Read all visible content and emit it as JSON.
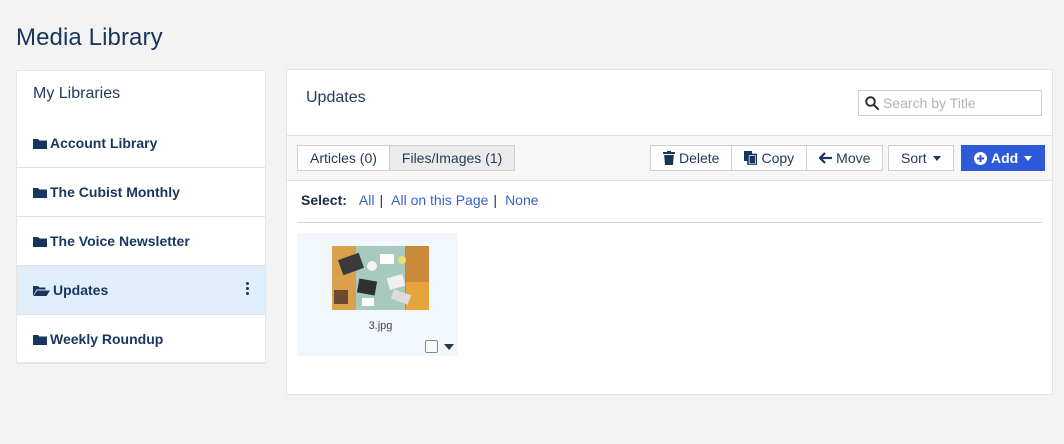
{
  "page_title": "Media Library",
  "sidebar": {
    "heading": "My Libraries",
    "items": [
      {
        "label": "Account Library",
        "icon": "folder-icon"
      },
      {
        "label": "The Cubist Monthly",
        "icon": "folder-icon"
      },
      {
        "label": "The Voice Newsletter",
        "icon": "folder-icon"
      },
      {
        "label": "Updates",
        "icon": "folder-open-icon",
        "active": true
      },
      {
        "label": "Weekly Roundup",
        "icon": "folder-icon"
      }
    ]
  },
  "main": {
    "title": "Updates",
    "search": {
      "placeholder": "Search by Title",
      "value": ""
    },
    "tabs": [
      {
        "label": "Articles (0)",
        "active": false
      },
      {
        "label": "Files/Images (1)",
        "active": true
      }
    ],
    "actions": {
      "delete": "Delete",
      "copy": "Copy",
      "move": "Move",
      "sort": "Sort",
      "add": "Add"
    },
    "select": {
      "label": "Select:",
      "all": "All",
      "all_on_page": "All on this Page",
      "none": "None"
    },
    "files": [
      {
        "name": "3.jpg"
      }
    ]
  },
  "colors": {
    "accent": "#2e59d9",
    "active_row": "#e0eefb",
    "link": "#3a5fc9"
  }
}
